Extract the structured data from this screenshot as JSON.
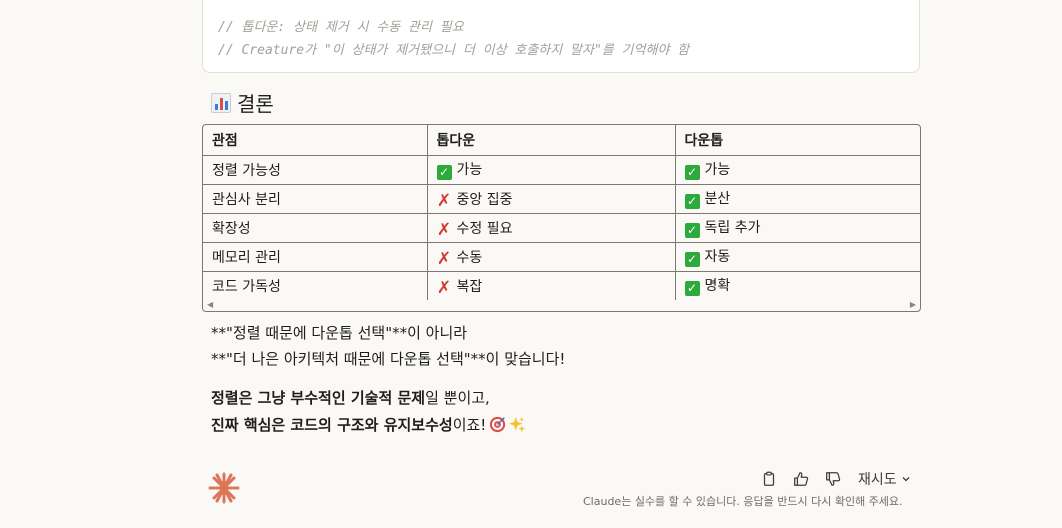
{
  "code": {
    "line1": "// 톱다운: 상태 제거 시 수동 관리 필요",
    "line2": "// Creature가 \"이 상태가 제거됐으니 더 이상 호출하지 말자\"를 기억해야 함"
  },
  "section": {
    "title": "결론",
    "icon": "bar-chart-icon"
  },
  "table": {
    "headers": [
      "관점",
      "톱다운",
      "다운톱"
    ],
    "rows": [
      {
        "aspect": "정렬 가능성",
        "top_down": "가능",
        "top_down_mark": "check",
        "down_top": "가능",
        "down_top_mark": "check"
      },
      {
        "aspect": "관심사 분리",
        "top_down": "중앙 집중",
        "top_down_mark": "cross",
        "down_top": "분산",
        "down_top_mark": "check"
      },
      {
        "aspect": "확장성",
        "top_down": "수정 필요",
        "top_down_mark": "cross",
        "down_top": "독립 추가",
        "down_top_mark": "check"
      },
      {
        "aspect": "메모리 관리",
        "top_down": "수동",
        "top_down_mark": "cross",
        "down_top": "자동",
        "down_top_mark": "check"
      },
      {
        "aspect": "코드 가독성",
        "top_down": "복잡",
        "top_down_mark": "cross",
        "down_top": "명확",
        "down_top_mark": "check"
      }
    ]
  },
  "body": {
    "line1": "**\"정렬 때문에 다운톱 선택\"**이 아니라",
    "line2": "**\"더 나은 아키텍처 때문에 다운톱 선택\"**이 맞습니다!",
    "line3_bold": "정렬은 그냥 부수적인 기술적 문제",
    "line3_rest": "일 뿐이고,",
    "line4_bold": "진짜 핵심은 코드의 구조와 유지보수성",
    "line4_rest": "이죠!",
    "emojis": [
      "target-icon",
      "sparkles-icon"
    ]
  },
  "footer": {
    "retry_label": "재시도",
    "disclaimer": "Claude는 실수를 할 수 있습니다. 응답을 반드시 다시 확인해 주세요.",
    "colors": {
      "accent": "#d97757",
      "check": "#2eaa3c",
      "cross": "#d13a2e"
    }
  }
}
